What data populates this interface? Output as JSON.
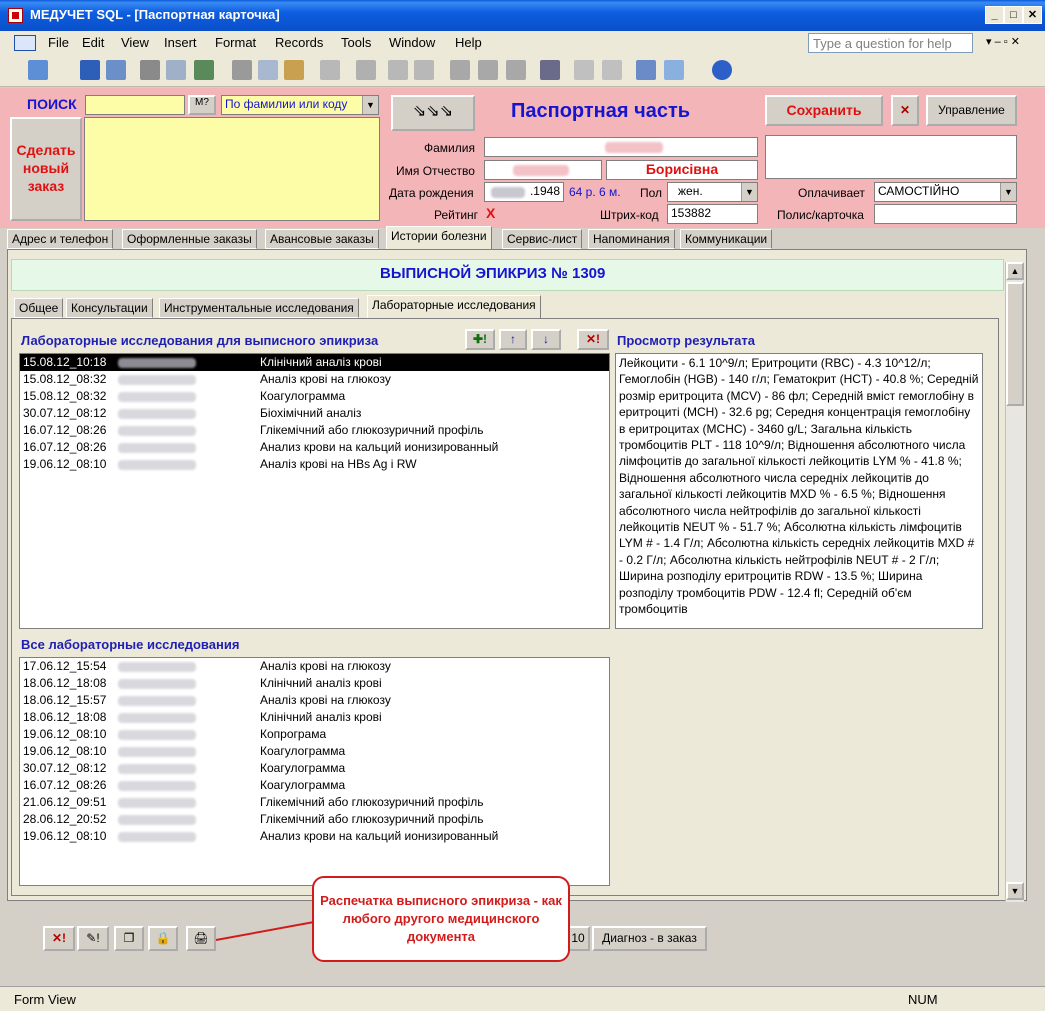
{
  "window": {
    "title": "МЕДУЧЕТ SQL - [Паспортная карточка]"
  },
  "menu": [
    "File",
    "Edit",
    "View",
    "Insert",
    "Format",
    "Records",
    "Tools",
    "Window",
    "Help"
  ],
  "help_placeholder": "Type a question for help",
  "search": {
    "label": "ПОИСК",
    "mode": "По фамилии или коду"
  },
  "new_order": "Сделать новый заказ",
  "passport_title": "Паспортная часть",
  "buttons": {
    "save": "Сохранить",
    "manage": "Управление"
  },
  "fields": {
    "surname_label": "Фамилия",
    "name_label": "Имя Отчество",
    "patronymic": "Борисівна",
    "dob_label": "Дата рождения",
    "dob": ".1948",
    "age": "64 р. 6 м.",
    "sex_label": "Пол",
    "sex": "жен.",
    "payer_label": "Оплачивает",
    "payer": "САМОСТІЙНО",
    "rating_label": "Рейтинг",
    "rating": "X",
    "barcode_label": "Штрих-код",
    "barcode": "153882",
    "policy_label": "Полис/карточка"
  },
  "main_tabs": [
    "Адрес и телефон",
    "Оформленные заказы",
    "Авансовые заказы",
    "Истории болезни",
    "Сервис-лист",
    "Напоминания",
    "Коммуникации"
  ],
  "epicrisis_title": "ВЫПИСНОЙ ЭПИКРИЗ № 1309",
  "sub_tabs": [
    "Общее",
    "Консультации",
    "Инструментальные исследования",
    "Лабораторные исследования"
  ],
  "lab_list_title": "Лабораторные исследования для выписного эпикриза",
  "result_title": "Просмотр результата",
  "lab_rows": [
    {
      "date": "15.08.12_10:18",
      "name": "Клінічний аналіз крові"
    },
    {
      "date": "15.08.12_08:32",
      "name": "Аналіз крові на глюкозу"
    },
    {
      "date": "15.08.12_08:32",
      "name": "Коагулограмма"
    },
    {
      "date": "30.07.12_08:12",
      "name": "Біохімічний аналіз"
    },
    {
      "date": "16.07.12_08:26",
      "name": "Глікемічний або глюкозуричний профіль"
    },
    {
      "date": "16.07.12_08:26",
      "name": "Анализ крови на кальций ионизированный"
    },
    {
      "date": "19.06.12_08:10",
      "name": "Аналіз крові на HBs Ag і RW"
    }
  ],
  "result_text": "Лейкоцити - 6.1 10^9/л; Еритроцити (RBC) - 4.3 10^12/л; Гемоглобін (HGB) - 140 г/л; Гематокрит (HCT) - 40.8 %; Середній розмір еритроцита (MCV) - 86 фл; Середній вміст гемоглобіну в  еритроциті (MCH) - 32.6 pg; Середня концентрація гемоглобіну в еритроцитах (MCHC) - 3460 g/L; Загальна кількість тромбоцитів PLT - 118 10^9/л; Відношення абсолютного числа лімфоцитів до загальної кількості лейкоцитів LYM % - 41.8 %; Відношення абсолютного числа середніх лейкоцитів до загальної кількості лейкоцитів MXD % - 6.5 %; Відношення абсолютного числа нейтрофілів  до загальної  кількості лейкоцитів NEUT % - 51.7 %; Абсолютна кількість лімфоцитів LYM # - 1.4 Г/л; Абсолютна кількість  середніх лейкоцитів MXD # - 0.2 Г/л; Абсолютна кількість нейтрофілів NEUT # - 2 Г/л; Ширина розподілу еритроцитів RDW - 13.5 %; Ширина розподілу тромбоцитів  PDW - 12.4  fl; Середній об'єм тромбоцитів",
  "all_lab_title": "Все лабораторные исследования",
  "all_rows": [
    {
      "date": "17.06.12_15:54",
      "name": "Аналіз крові на глюкозу"
    },
    {
      "date": "18.06.12_18:08",
      "name": "Клінічний аналіз крові"
    },
    {
      "date": "18.06.12_15:57",
      "name": "Аналіз крові на глюкозу"
    },
    {
      "date": "18.06.12_18:08",
      "name": "Клінічний аналіз крові"
    },
    {
      "date": "19.06.12_08:10",
      "name": "Копрограма"
    },
    {
      "date": "19.06.12_08:10",
      "name": "Коагулограмма"
    },
    {
      "date": "30.07.12_08:12",
      "name": "Коагулограмма"
    },
    {
      "date": "16.07.12_08:26",
      "name": "Коагулограмма"
    },
    {
      "date": "21.06.12_09:51",
      "name": "Глікемічний або глюкозуричний профіль"
    },
    {
      "date": "28.06.12_20:52",
      "name": "Глікемічний або глюкозуричний профіль"
    },
    {
      "date": "19.06.12_08:10",
      "name": "Анализ крови на кальций ионизированный"
    }
  ],
  "bottom": {
    "num10": "10",
    "diagnosis": "Диагноз - в заказ"
  },
  "callout": "Распечатка выписного эпикриза - как любого другого медицинского документа",
  "status": {
    "left": "Form View",
    "num": "NUM"
  }
}
